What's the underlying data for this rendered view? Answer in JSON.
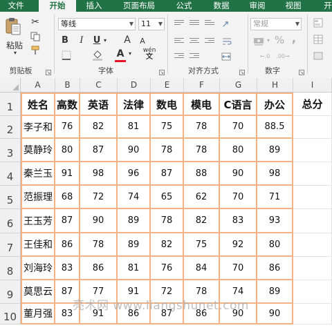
{
  "menu": [
    {
      "label": "文件"
    },
    {
      "label": "开始"
    },
    {
      "label": "插入"
    },
    {
      "label": "页面布局"
    },
    {
      "label": "公式"
    },
    {
      "label": "数据"
    },
    {
      "label": "审阅"
    },
    {
      "label": "视图"
    },
    {
      "label": "开"
    }
  ],
  "ribbon": {
    "clipboard": {
      "label": "剪贴板",
      "paste": "粘贴"
    },
    "font": {
      "label": "字体",
      "name": "等线",
      "size": "11",
      "bold": "B",
      "italic": "I",
      "underline": "U",
      "grow": "A",
      "shrink": "A",
      "font_color": "A",
      "phonetic": "wén",
      "font_color_value": "#e81123"
    },
    "alignment": {
      "label": "对齐方式"
    },
    "number": {
      "label": "数字",
      "format": "常规",
      "percent": "%",
      "comma": ","
    }
  },
  "sheet": {
    "columns": [
      "A",
      "B",
      "C",
      "D",
      "E",
      "F",
      "G",
      "H",
      "I"
    ],
    "headers": [
      "姓名",
      "高数",
      "英语",
      "法律",
      "数电",
      "模电",
      "C语言",
      "办公",
      "总分"
    ],
    "rows": [
      {
        "row": "2",
        "name": "李子和",
        "values": [
          "76",
          "82",
          "81",
          "75",
          "78",
          "70",
          "88.5"
        ]
      },
      {
        "row": "3",
        "name": "莫静玲",
        "values": [
          "80",
          "87",
          "90",
          "78",
          "78",
          "80",
          "89"
        ]
      },
      {
        "row": "4",
        "name": "秦兰玉",
        "values": [
          "91",
          "98",
          "96",
          "87",
          "88",
          "90",
          "98"
        ]
      },
      {
        "row": "5",
        "name": "范振理",
        "values": [
          "68",
          "72",
          "74",
          "65",
          "62",
          "70",
          "71"
        ]
      },
      {
        "row": "6",
        "name": "王玉芳",
        "values": [
          "87",
          "90",
          "89",
          "78",
          "82",
          "83",
          "93"
        ]
      },
      {
        "row": "7",
        "name": "王佳和",
        "values": [
          "86",
          "78",
          "89",
          "82",
          "75",
          "92",
          "80"
        ]
      },
      {
        "row": "8",
        "name": "刘海玲",
        "values": [
          "83",
          "86",
          "81",
          "76",
          "84",
          "70",
          "86"
        ]
      },
      {
        "row": "9",
        "name": "莫思云",
        "values": [
          "87",
          "77",
          "91",
          "72",
          "78",
          "74",
          "89"
        ]
      },
      {
        "row": "10",
        "name": "董月强",
        "values": [
          "83",
          "91",
          "86",
          "87",
          "86",
          "90",
          "90"
        ]
      }
    ],
    "header_row": "1"
  },
  "watermark": "亮术网 www.liangshunet.com"
}
